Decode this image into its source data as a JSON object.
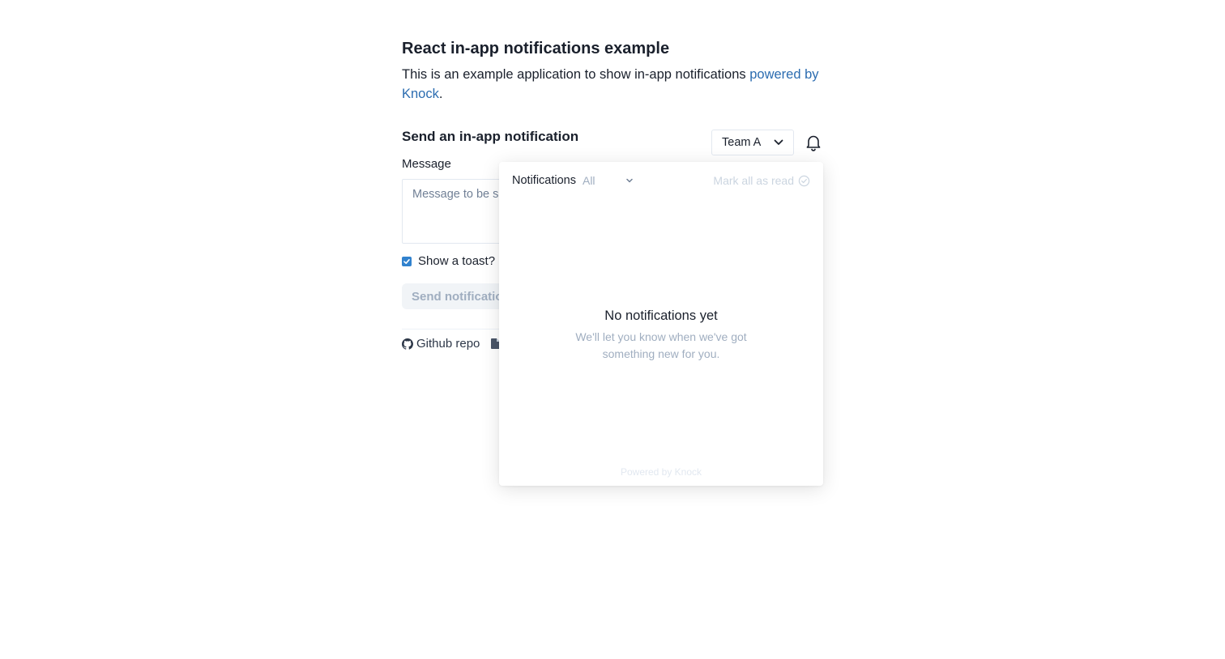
{
  "header": {
    "title": "React in-app notifications example",
    "intro_text": "This is an example application to show in-app notifications ",
    "intro_link": "powered by Knock",
    "intro_end": "."
  },
  "form": {
    "section_title": "Send an in-app notification",
    "message_label": "Message",
    "message_placeholder": "Message to be sent",
    "toast_label": "Show a toast?",
    "toast_checked": true,
    "send_label": "Send notification"
  },
  "footer": {
    "github_label": "Github repo",
    "docs_icon": "file-icon"
  },
  "controls": {
    "team_value": "Team A",
    "bell_icon": "bell-icon"
  },
  "popover": {
    "title": "Notifications",
    "filter_value": "All",
    "mark_all_label": "Mark all as read",
    "empty_title": "No notifications yet",
    "empty_subtitle": "We'll let you know when we've got something new for you.",
    "powered_by": "Powered by Knock"
  },
  "colors": {
    "link": "#2b6cb0",
    "checkbox": "#3182ce",
    "muted": "#a0aec0"
  }
}
